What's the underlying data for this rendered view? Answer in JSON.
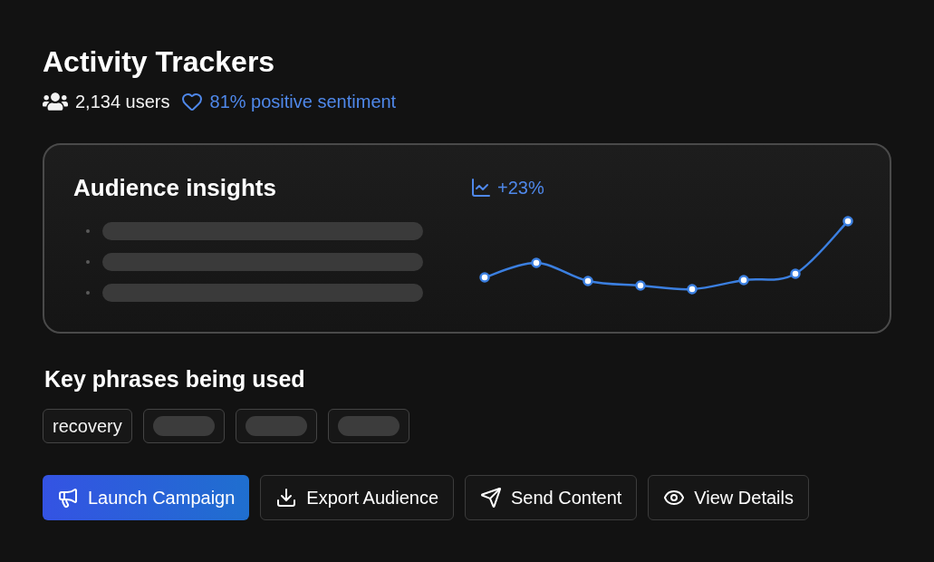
{
  "header": {
    "title": "Activity Trackers",
    "users": "2,134 users",
    "sentiment": "81% positive sentiment"
  },
  "insights": {
    "title": "Audience insights",
    "lines": [
      {
        "kind": "skeleton"
      },
      {
        "kind": "skeleton"
      },
      {
        "kind": "skeleton"
      }
    ],
    "trend": "+23%"
  },
  "phrases": {
    "title": "Key phrases being used",
    "items": [
      {
        "kind": "text",
        "label": "recovery"
      },
      {
        "kind": "skeleton"
      },
      {
        "kind": "skeleton"
      },
      {
        "kind": "skeleton"
      }
    ]
  },
  "actions": [
    {
      "label": "Launch Campaign",
      "kind": "primary"
    },
    {
      "label": "Export Audience",
      "kind": "secondary"
    },
    {
      "label": "Send Content",
      "kind": "secondary"
    },
    {
      "label": "View Details",
      "kind": "secondary"
    }
  ]
}
